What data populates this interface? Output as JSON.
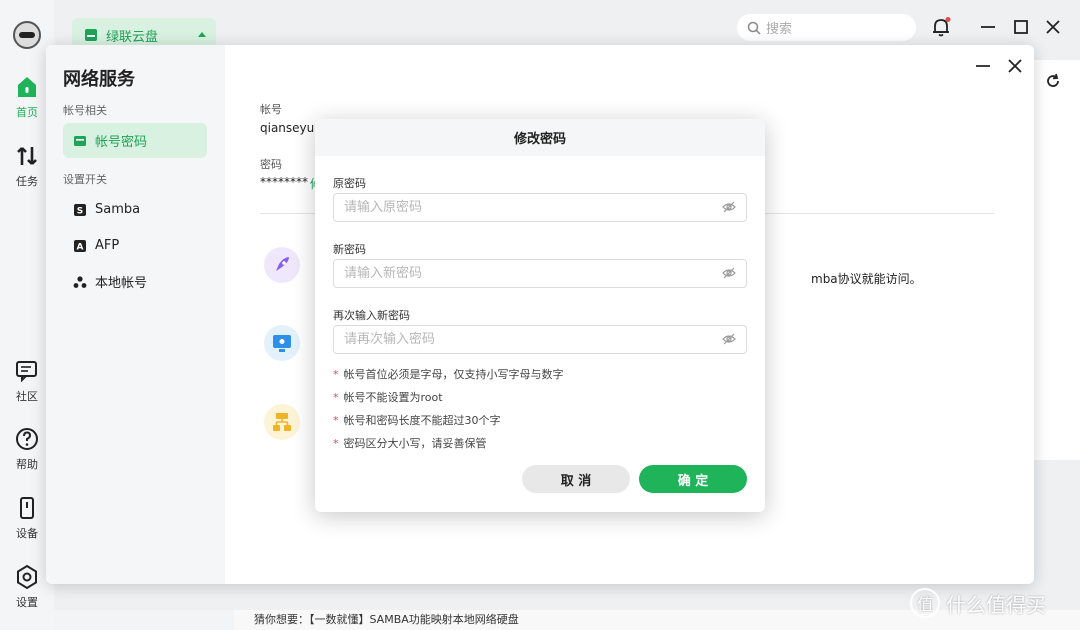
{
  "nav": {
    "items": [
      {
        "label": "首页",
        "icon": "home-icon"
      },
      {
        "label": "任务",
        "icon": "transfer-icon"
      },
      {
        "label": "社区",
        "icon": "chat-icon"
      },
      {
        "label": "帮助",
        "icon": "help-icon"
      },
      {
        "label": "设备",
        "icon": "device-icon"
      },
      {
        "label": "设置",
        "icon": "settings-icon"
      }
    ]
  },
  "topbar": {
    "drive_label": "绿联云盘",
    "search_placeholder": "搜索"
  },
  "panel": {
    "title": "网络服务",
    "section_account": "帐号相关",
    "section_switch": "设置开关",
    "items": [
      {
        "label": "帐号密码",
        "icon": "card-icon"
      },
      {
        "label": "Samba",
        "icon": "samba-icon"
      },
      {
        "label": "AFP",
        "icon": "afp-icon"
      },
      {
        "label": "本地帐号",
        "icon": "local-account-icon"
      }
    ],
    "account_label": "帐号",
    "account_value": "qianseyue",
    "password_label": "密码",
    "password_value": "********",
    "edit_glyph": "修",
    "samba_desc_fragment": "mba协议就能访问。"
  },
  "dialog": {
    "title": "修改密码",
    "old_label": "原密码",
    "old_placeholder": "请输入原密码",
    "new_label": "新密码",
    "new_placeholder": "请输入新密码",
    "confirm_label": "再次输入新密码",
    "confirm_placeholder": "请再次输入密码",
    "notes": [
      "帐号首位必须是字母，仅支持小写字母与数字",
      "帐号不能设置为root",
      "帐号和密码长度不能超过30个字",
      "密码区分大小写，请妥善保管"
    ],
    "cancel_label": "取 消",
    "ok_label": "确 定"
  },
  "bottom_bar": {
    "text": "猜你想要：【一数就懂】SAMBA功能映射本地网络硬盘"
  },
  "watermark": {
    "text": "什么值得买",
    "glyph": "值"
  },
  "colors": {
    "accent": "#1fb35a",
    "accent_light": "#d8f1e0",
    "required_star": "#e14b4b"
  }
}
